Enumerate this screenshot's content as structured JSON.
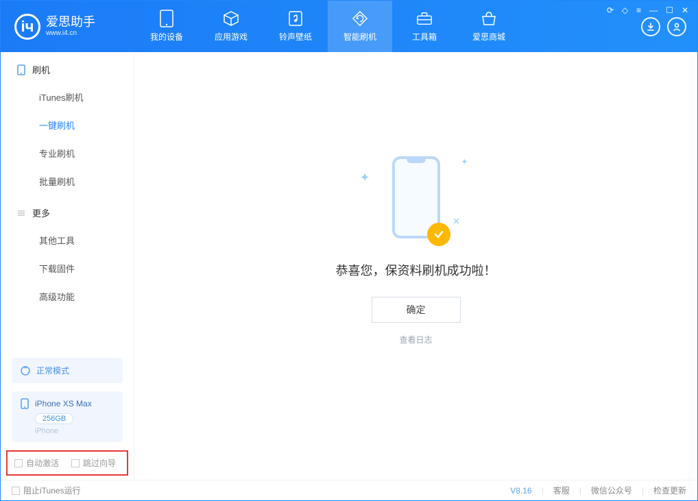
{
  "app": {
    "title": "爱思助手",
    "url": "www.i4.cn"
  },
  "nav": {
    "items": [
      {
        "label": "我的设备",
        "icon": "device-icon"
      },
      {
        "label": "应用游戏",
        "icon": "cube-icon"
      },
      {
        "label": "铃声壁纸",
        "icon": "music-icon"
      },
      {
        "label": "智能刷机",
        "icon": "refresh-icon",
        "active": true
      },
      {
        "label": "工具箱",
        "icon": "toolbox-icon"
      },
      {
        "label": "爱思商城",
        "icon": "shop-icon"
      }
    ]
  },
  "sidebar": {
    "sections": [
      {
        "title": "刷机",
        "icon": "phone-icon",
        "items": [
          {
            "label": "iTunes刷机"
          },
          {
            "label": "一键刷机",
            "active": true
          },
          {
            "label": "专业刷机"
          },
          {
            "label": "批量刷机"
          }
        ]
      },
      {
        "title": "更多",
        "icon": "menu-icon",
        "items": [
          {
            "label": "其他工具"
          },
          {
            "label": "下载固件"
          },
          {
            "label": "高级功能"
          }
        ]
      }
    ],
    "mode": {
      "label": "正常模式",
      "icon": "spinner-icon"
    },
    "device": {
      "name": "iPhone XS Max",
      "storage": "256GB",
      "type": "iPhone"
    },
    "checkboxes": {
      "auto_activate": "自动激活",
      "skip_guide": "跳过向导"
    }
  },
  "main": {
    "success_message": "恭喜您，保资料刷机成功啦！",
    "confirm_label": "确定",
    "view_log_label": "查看日志"
  },
  "statusbar": {
    "block_itunes": "阻止iTunes运行",
    "version": "V8.16",
    "links": {
      "support": "客服",
      "wechat": "微信公众号",
      "update": "检查更新"
    }
  },
  "colors": {
    "accent": "#2186f8",
    "warn_badge": "#ffb800",
    "highlight_border": "#e63939"
  }
}
